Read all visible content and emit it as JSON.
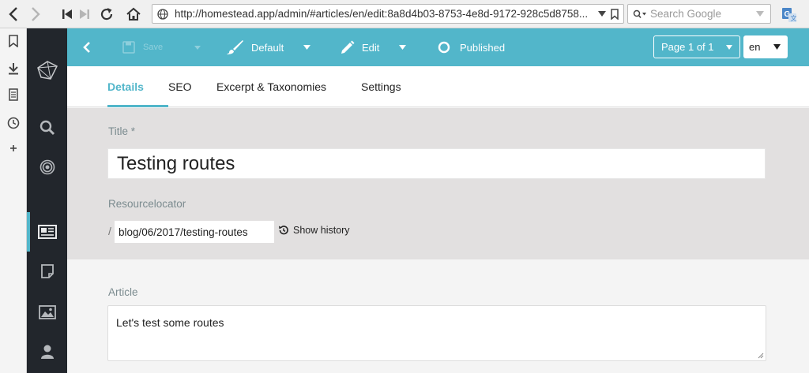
{
  "browser": {
    "url": "http://homestead.app/admin/#articles/en/edit:8a8d4b03-8753-4e8d-9172-928c5d8758...",
    "search_placeholder": "Search Google"
  },
  "header": {
    "save_label": "Save",
    "template_label": "Default",
    "edit_label": "Edit",
    "status_label": "Published",
    "page_label": "Page 1 of 1",
    "locale": "en"
  },
  "tabs": [
    {
      "label": "Details"
    },
    {
      "label": "SEO"
    },
    {
      "label": "Excerpt & Taxonomies"
    },
    {
      "label": "Settings"
    }
  ],
  "form": {
    "title_label": "Title *",
    "title_value": "Testing routes",
    "resource_label": "Resourcelocator",
    "resource_prefix": "/",
    "resource_value": "blog/06/2017/testing-routes",
    "history_label": "Show history",
    "article_label": "Article",
    "article_value": "Let's test some routes"
  },
  "colors": {
    "accent": "#52b6ca",
    "nav_bg": "#22262c"
  }
}
